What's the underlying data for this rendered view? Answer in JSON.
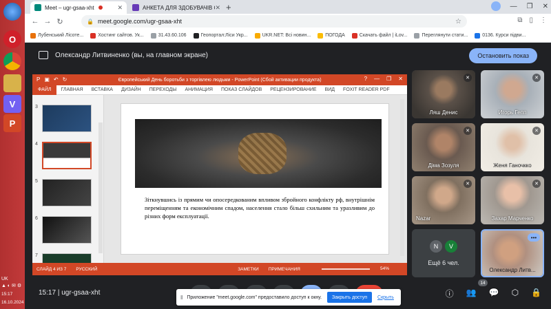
{
  "taskbar": {
    "tray_lang": "UK",
    "clock_time": "15:17",
    "clock_date": "16.10.2024"
  },
  "browser": {
    "tabs": [
      {
        "label": "Meet – ugr-gsaa-xht",
        "active": true
      },
      {
        "label": "АНКЕТА ДЛЯ ЗДОБУВАЧІВ ОСВІ",
        "active": false
      }
    ],
    "url": "meet.google.com/ugr-gsaa-xht",
    "bookmarks": [
      "Лубенський Лісоте...",
      "Хостинг сайтов. Ук...",
      "31.43.60.106",
      "Геопортал:Ліси Укр...",
      "UKR.NET: Всі новин...",
      "ПОГОДА",
      "Скачать файл | iLov...",
      "Переглянути стати...",
      "0136. Курси підви..."
    ]
  },
  "meet": {
    "presenter_text": "Олександр Литвиненко (вы, на главном экране)",
    "stop_button": "Остановить показ",
    "meeting_time": "15:17",
    "meeting_code": "ugr-gsaa-xht",
    "participant_count": "14",
    "participants": [
      {
        "name": "Ляш Денис"
      },
      {
        "name": "Игорь Гепп"
      },
      {
        "name": "Діма Зозуля"
      },
      {
        "name": "Женя Ганочкко"
      },
      {
        "name": "Nazar"
      },
      {
        "name": "Захар Марченко"
      },
      {
        "name": "Олександр Литв..."
      }
    ],
    "more": {
      "initials": [
        "N",
        "V"
      ],
      "label": "Ещё 6 чел."
    }
  },
  "powerpoint": {
    "title": "Європейський День боротьби з торгівлею людьми - PowerPoint (Сбой активации продукта)",
    "ribbon_tabs": [
      "ФАЙЛ",
      "ГЛАВНАЯ",
      "ВСТАВКА",
      "ДИЗАЙН",
      "ПЕРЕХОДЫ",
      "АНИМАЦИЯ",
      "ПОКАЗ СЛАЙДОВ",
      "РЕЦЕНЗИРОВАНИЕ",
      "ВИД",
      "FOXIT READER PDF"
    ],
    "slide_numbers": [
      "3",
      "4",
      "5",
      "6",
      "7"
    ],
    "slide_text": "Зіткнувшись із прямим чи опосередкованим впливом збройного конфлікту рф, внутрішнім переміщенням та економічним спадом, населення стало більш схильним та уразливим до різних форм експлуатації.",
    "status_slide": "СЛАЙД 4 ИЗ 7",
    "status_lang": "РУССКИЙ",
    "notes": "ЗАМЕТКИ",
    "comments": "ПРИМЕЧАНИЯ",
    "zoom": "54%"
  },
  "notification": {
    "text": "Приложение \"meet.google.com\" предоставило доступ к окну.",
    "grant": "Закрыть доступ",
    "hide": "Скрыть"
  }
}
